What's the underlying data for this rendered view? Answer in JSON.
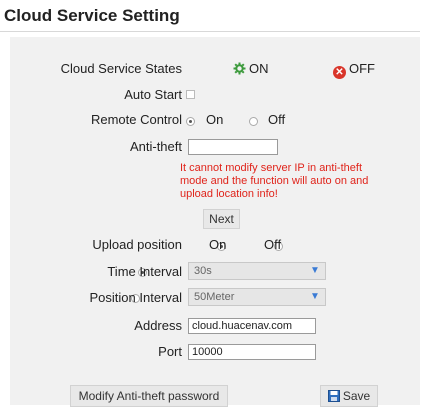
{
  "title": "Cloud Service Setting",
  "cloud_service_states": {
    "label": "Cloud Service States",
    "on_label": "ON",
    "off_label": "OFF"
  },
  "auto_start": {
    "label": "Auto Start",
    "checked": false
  },
  "remote_control": {
    "label": "Remote Control",
    "on_label": "On",
    "off_label": "Off",
    "selected": "On"
  },
  "anti_theft": {
    "label": "Anti-theft",
    "value": "",
    "warning": "It cannot modify server IP in anti-theft mode and the function will auto on and upload location info!",
    "next_label": "Next"
  },
  "upload_position": {
    "label": "Upload position",
    "on_label": "On",
    "off_label": "Off",
    "selected": "On"
  },
  "time_interval": {
    "label": "Time Interval",
    "value": "30s",
    "selected": true
  },
  "position_interval": {
    "label": "Position Interval",
    "value": "50Meter",
    "selected": false
  },
  "address": {
    "label": "Address",
    "value": "cloud.huacenav.com"
  },
  "port": {
    "label": "Port",
    "value": "10000"
  },
  "buttons": {
    "modify_password": "Modify Anti-theft password",
    "save": "Save"
  },
  "colors": {
    "on_icon": "#3c9a3c",
    "off_icon": "#d9352a",
    "warning": "#e0241b",
    "save_icon": "#2f6fbf"
  }
}
